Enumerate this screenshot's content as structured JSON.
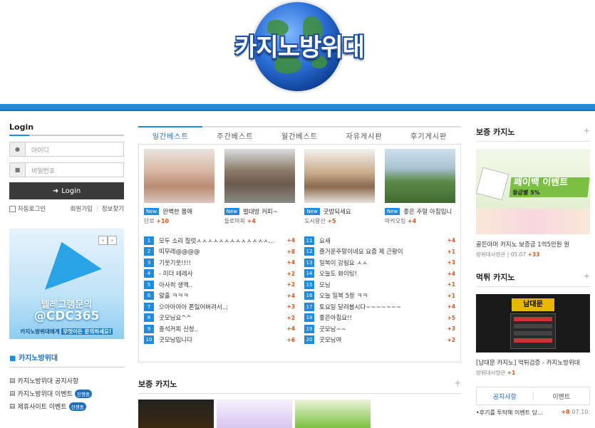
{
  "site": {
    "logo_text": "카지노방위대"
  },
  "login": {
    "title": "Login",
    "id_placeholder": "아이디",
    "pw_placeholder": "비밀번호",
    "button": "Login",
    "auto_login": "자동로그인",
    "register": "회원가입",
    "info_find": "정보찾기"
  },
  "telegram": {
    "line1": "텔레그램문의",
    "line2": "@CDC365",
    "line3a": "카지노방위대에게 ",
    "line3b": "무엇이든 문의하세요!"
  },
  "sidebar": {
    "category": "카지노방위대",
    "items": [
      {
        "label": "카지노방위대 공지사항",
        "badge": ""
      },
      {
        "label": "카지노방위대 이벤트",
        "badge": "진행중"
      },
      {
        "label": "제휴사이트 이벤트",
        "badge": "진행중"
      }
    ]
  },
  "tabs": [
    "일간베스트",
    "주간베스트",
    "월간베스트",
    "자유게시판",
    "후기게시판"
  ],
  "thumbs": [
    {
      "new": "New",
      "title": "완벽한 몸매",
      "author": "단로",
      "score": "+10"
    },
    {
      "new": "New",
      "title": "벌대방 커피~",
      "author": "돌로마피",
      "score": "+4"
    },
    {
      "new": "New",
      "title": "굿밤되세요",
      "author": "도시왕산",
      "score": "+5"
    },
    {
      "new": "New",
      "title": "좋은 주말 아침입니",
      "author": "마카오킹",
      "score": "+4"
    }
  ],
  "list_left": [
    {
      "n": "1",
      "title": "모두 소리 질럿ㅅㅅㅅㅅㅅㅅㅅㅅㅅㅅㅅㅅㅅ…",
      "score": "+4"
    },
    {
      "n": "2",
      "title": "띠무레@@@@",
      "score": "+8"
    },
    {
      "n": "3",
      "title": "기웃기웃!!!!",
      "score": "+4"
    },
    {
      "n": "4",
      "title": "- 미더 테레사",
      "score": "+2"
    },
    {
      "n": "5",
      "title": "아사히 생맥..",
      "score": "+2"
    },
    {
      "n": "6",
      "title": "얇홀 ㅋㅋㅋ",
      "score": "+4"
    },
    {
      "n": "7",
      "title": "으아아아아 폰잃어버려서..;",
      "score": "+3"
    },
    {
      "n": "8",
      "title": "굿모닝요^^",
      "score": "+2"
    },
    {
      "n": "9",
      "title": "출석커피 신청..",
      "score": "+4"
    },
    {
      "n": "10",
      "title": "굿모닝입니다",
      "score": "+6"
    }
  ],
  "list_right": [
    {
      "n": "11",
      "title": "요새",
      "score": "+4"
    },
    {
      "n": "12",
      "title": "즐거운주말이네요 요즘 제 근황이",
      "score": "+1"
    },
    {
      "n": "13",
      "title": "일복이 강림요 ㅅㅅ",
      "score": "+3"
    },
    {
      "n": "14",
      "title": "오늘도 화이팅!",
      "score": "+4"
    },
    {
      "n": "15",
      "title": "모닝",
      "score": "+1"
    },
    {
      "n": "16",
      "title": "오늘 일복 5등 ㅋㅋ",
      "score": "+1"
    },
    {
      "n": "17",
      "title": "토요일 달려봅시다~~~~~~~",
      "score": "+4"
    },
    {
      "n": "18",
      "title": "좋은아침요!!",
      "score": "+5"
    },
    {
      "n": "19",
      "title": "굿모닝~~",
      "score": "+3"
    },
    {
      "n": "20",
      "title": "굿모닝여",
      "score": "+2"
    }
  ],
  "center_bottom": {
    "title": "보증 카지노",
    "plus": "+"
  },
  "right": {
    "sec1_title": "보증 카지노",
    "ad1_head": "페이백 이벤트",
    "ad1_sub": "등급별 5%",
    "ad1_caption": "골든아머 카지노 보증금 1억5만원 원",
    "ad1_author": "방위대사령관",
    "ad1_date": "05.07",
    "ad1_score": "+33",
    "sec2_title": "먹튀 카지노",
    "ad2_logo": "남대문",
    "ad2_caption": "[남대문 카지노] 먹튀검증 - 카지노방위대",
    "ad2_author": "방위대사령관",
    "ad2_score": "+1",
    "plus": "+",
    "ntab_active": "공지사항",
    "ntab_other": "이벤트",
    "notice_title": "•후기를 투탁해 이벤트 당…",
    "notice_score": "+8",
    "notice_date": "07.10."
  }
}
